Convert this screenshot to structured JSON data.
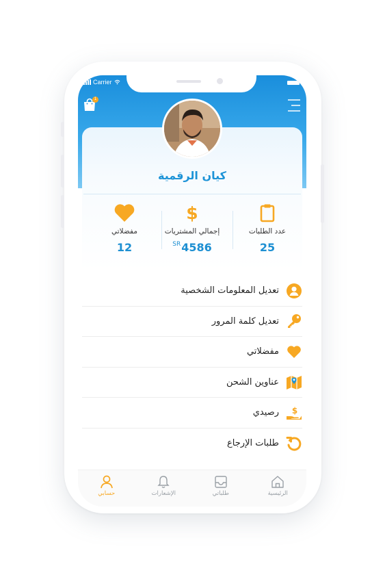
{
  "status_bar": {
    "carrier": "Carrier"
  },
  "header": {
    "cart_badge": "1"
  },
  "profile": {
    "name": "كيان الرقمية"
  },
  "stats": [
    {
      "label": "مفضلاتي",
      "value": "12",
      "icon": "heart-icon"
    },
    {
      "label": "إجمالي المشتريات",
      "value": "4586",
      "currency": "SR",
      "icon": "dollar-icon"
    },
    {
      "label": "عدد الطلبات",
      "value": "25",
      "icon": "clipboard-icon"
    }
  ],
  "menu": [
    {
      "label": "تعديل المعلومات الشخصية",
      "icon": "user-icon"
    },
    {
      "label": "تعديل كلمة المرور",
      "icon": "key-icon"
    },
    {
      "label": "مفضلاتي",
      "icon": "heart-icon"
    },
    {
      "label": "عناوين الشحن",
      "icon": "map-icon"
    },
    {
      "label": "رصيدي",
      "icon": "wallet-hand-icon"
    },
    {
      "label": "طلبات الإرجاع",
      "icon": "return-icon"
    }
  ],
  "tabs": [
    {
      "label": "حسابي",
      "active": true,
      "icon": "user-icon"
    },
    {
      "label": "الإشعارات",
      "active": false,
      "icon": "bell-icon"
    },
    {
      "label": "طلباتي",
      "active": false,
      "icon": "inbox-icon"
    },
    {
      "label": "الرئيسية",
      "active": false,
      "icon": "home-icon"
    }
  ],
  "colors": {
    "primary": "#1d93d7",
    "accent": "#f7a823",
    "header_gradient_top": "#1a8edc"
  }
}
